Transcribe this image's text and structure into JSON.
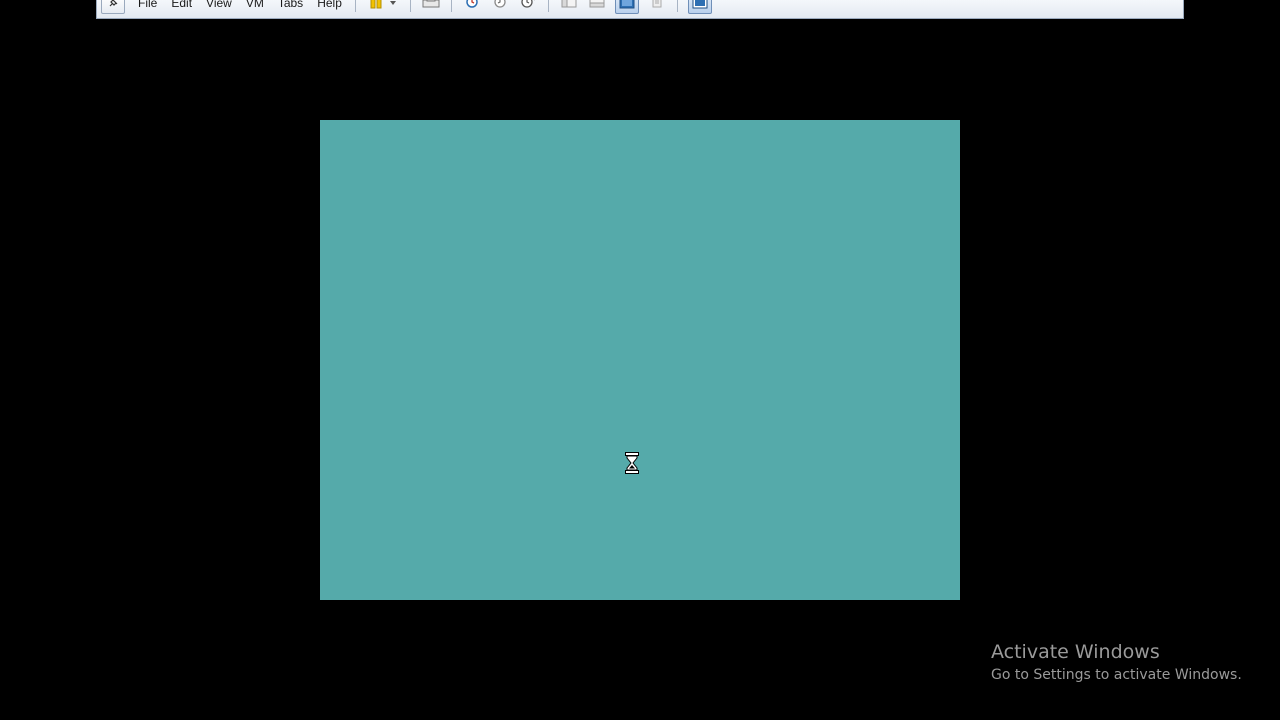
{
  "toolbar": {
    "menu": [
      "File",
      "Edit",
      "View",
      "VM",
      "Tabs",
      "Help"
    ]
  },
  "icons": {
    "pin": "pin-icon",
    "pause": "pause-icon",
    "send_ctrl_alt_del": "send-keys-icon",
    "snapshot": "snapshot-icon",
    "revert_snapshot": "revert-snapshot-icon",
    "snapshot_manager": "snapshot-manager-icon",
    "library": "library-icon",
    "thumbnail": "thumbnail-icon",
    "full_screen": "full-screen-icon",
    "unity": "unity-icon",
    "console_view": "console-view-icon",
    "cursor": "hourglass-cursor-icon"
  },
  "colors": {
    "background": "#000000",
    "guest_screen": "#55aaaa",
    "toolbar": "#e3e9f1",
    "watermark_text": "#9a9a9a"
  },
  "watermark": {
    "title": "Activate Windows",
    "subtitle": "Go to Settings to activate Windows."
  }
}
